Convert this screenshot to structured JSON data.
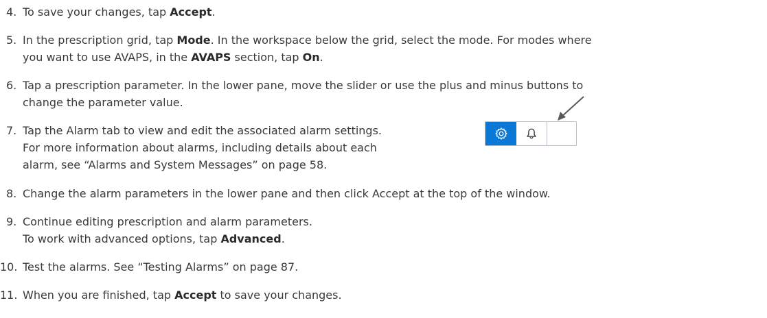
{
  "steps": [
    {
      "num": "4.",
      "pre": "To save your changes, tap ",
      "b1": "Accept",
      "post": "."
    },
    {
      "num": "5.",
      "l1a": "In the prescription grid, tap ",
      "l1b": "Mode",
      "l1c": ". In the workspace below the grid, select the mode. For modes where",
      "l2a": "you want to use AVAPS, in the ",
      "l2b": "AVAPS",
      "l2c": " section, tap ",
      "l2d": "On",
      "l2e": "."
    },
    {
      "num": "6.",
      "l1": "Tap a prescription parameter. In the lower pane, move the slider or use the plus and minus buttons to",
      "l2": "change the parameter value."
    },
    {
      "num": "7.",
      "l1": "Tap the Alarm tab to view and edit the associated alarm settings.",
      "l2": "For more information about alarms, including details about each",
      "l3": "alarm, see “Alarms and System Messages” on page 58."
    },
    {
      "num": "8.",
      "l1": "Change the alarm parameters in the lower pane and then click Accept at the top of the window."
    },
    {
      "num": "9.",
      "l1": "Continue editing prescription and alarm parameters.",
      "l2a": "To work with advanced options, tap ",
      "l2b": "Advanced",
      "l2c": "."
    },
    {
      "num": "10.",
      "l1": "Test the alarms. See “Testing Alarms” on page 87."
    },
    {
      "num": "11.",
      "pre": "When you are finished, tap ",
      "b1": "Accept",
      "post": " to save your changes."
    }
  ],
  "figure": {
    "tabs": [
      {
        "icon": "gear-icon",
        "selected": true
      },
      {
        "icon": "bell-icon",
        "selected": false
      }
    ],
    "accent_color": "#0a78d7"
  }
}
